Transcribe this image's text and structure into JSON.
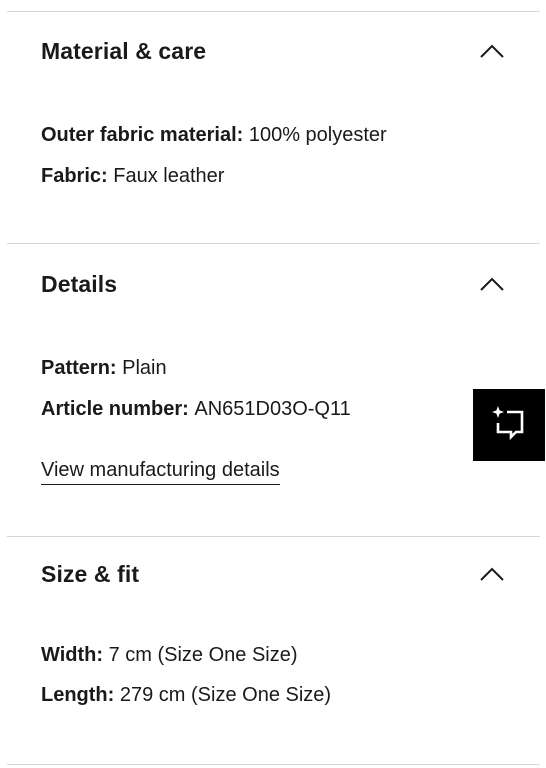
{
  "sections": [
    {
      "title": "Material & care",
      "icon": "chevron-up-icon",
      "attributes": [
        {
          "key": "Outer fabric material:",
          "value": "100% polyester"
        },
        {
          "key": "Fabric:",
          "value": "Faux leather"
        }
      ]
    },
    {
      "title": "Details",
      "icon": "chevron-up-icon",
      "attributes": [
        {
          "key": "Pattern:",
          "value": "Plain"
        },
        {
          "key": "Article number:",
          "value": "AN651D03O-Q11"
        }
      ],
      "link_label": "View manufacturing details"
    },
    {
      "title": "Size & fit",
      "icon": "chevron-up-icon",
      "attributes": [
        {
          "key": "Width:",
          "value": "7 cm (Size One Size)"
        },
        {
          "key": "Length:",
          "value": "279 cm (Size One Size)"
        }
      ]
    }
  ],
  "floating_button": {
    "icon": "sparkle-chat-icon",
    "background": "#000000"
  },
  "colors": {
    "text": "#1a1a1a",
    "divider": "#d6d6d6"
  }
}
